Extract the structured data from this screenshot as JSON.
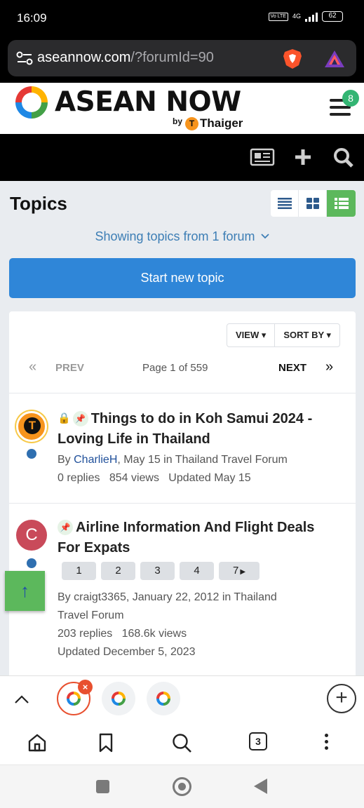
{
  "status_bar": {
    "time": "16:09",
    "volte": "Vo LTE",
    "network": "4G",
    "battery": "62"
  },
  "browser": {
    "url_domain": "aseannow.com",
    "url_path": "/?forumId=90",
    "tab_count": "3"
  },
  "site": {
    "logo_text": "ASEAN NOW",
    "logo_by": "by",
    "logo_t": "T",
    "logo_partner": "Thaiger",
    "notification_count": "8"
  },
  "topics_page": {
    "title": "Topics",
    "showing": "Showing topics from 1 forum",
    "start_button": "Start new topic",
    "view_label": "VIEW",
    "sort_label": "SORT BY",
    "prev": "PREV",
    "page_info": "Page 1 of 559",
    "next": "NEXT"
  },
  "topics": [
    {
      "title": "Things to do in Koh Samui 2024 - Loving Life in Thailand",
      "author": "CharlieH",
      "meta_rest": ", May 15 in Thailand Travel Forum",
      "avatar_letter": "T",
      "stats": "0 replies   854 views   Updated May 15",
      "locked": true,
      "pinned": true
    },
    {
      "title": "Airline Information And Flight Deals For Expats",
      "author": "craigt3365",
      "meta_line1": "By craigt3365, January 22, 2012 in Thailand",
      "meta_line2": "Travel Forum",
      "avatar_letter": "C",
      "stats": "203 replies   168.6k views",
      "updated": "Updated December 5, 2023",
      "pages": [
        "1",
        "2",
        "3",
        "4",
        "7"
      ],
      "pinned": true
    }
  ],
  "labels": {
    "by": "By "
  },
  "icons": {
    "scroll_top": "↑",
    "prev_arrow": "«",
    "next_arrow": "»",
    "chevron_up": "^",
    "new_tab": "+",
    "tab_close": "×",
    "lock": "🔒",
    "pin": "📌"
  },
  "colors": {
    "accent_blue": "#2f86d8",
    "accent_green": "#5cb85c",
    "link_blue": "#3d7eb5"
  }
}
